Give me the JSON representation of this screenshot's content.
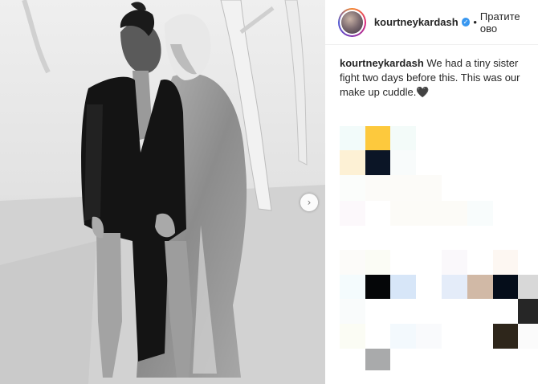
{
  "post": {
    "username": "kourtneykardash",
    "verified_icon": "verified-badge-icon",
    "separator": "•",
    "follow_label": "Пратите ово",
    "caption_user": "kourtneykardash",
    "caption_text": "We had a tiny sister fight two days before this. This was our make up cuddle.🖤",
    "next_icon": "chevron-right-icon"
  },
  "colors": {
    "accent": "#3897f0",
    "text": "#262626",
    "divider": "#efefef"
  }
}
